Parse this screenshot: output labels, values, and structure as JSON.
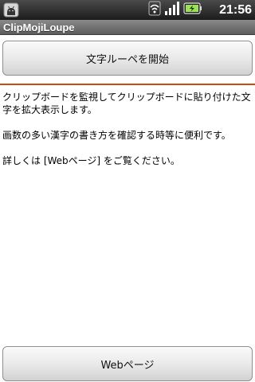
{
  "status_bar": {
    "time": "21:56",
    "icons": [
      "android-debug-icon",
      "wifi-icon",
      "signal-icon",
      "battery-charging-icon"
    ]
  },
  "app": {
    "title": "ClipMojiLoupe"
  },
  "buttons": {
    "start_label": "文字ルーペを開始",
    "web_label": "Webページ"
  },
  "description": {
    "para1": "クリップボードを監視してクリップボードに貼り付けた文字を拡大表示します。",
    "para2": "画数の多い漢字の書き方を確認する時等に便利です。",
    "para3": "詳しくは [Webページ] をご覧ください。"
  },
  "colors": {
    "divider": "#c84b12",
    "status_bar": "#1c1c1c",
    "title_bar": "#5c5c5c",
    "battery": "#9ee05a"
  }
}
